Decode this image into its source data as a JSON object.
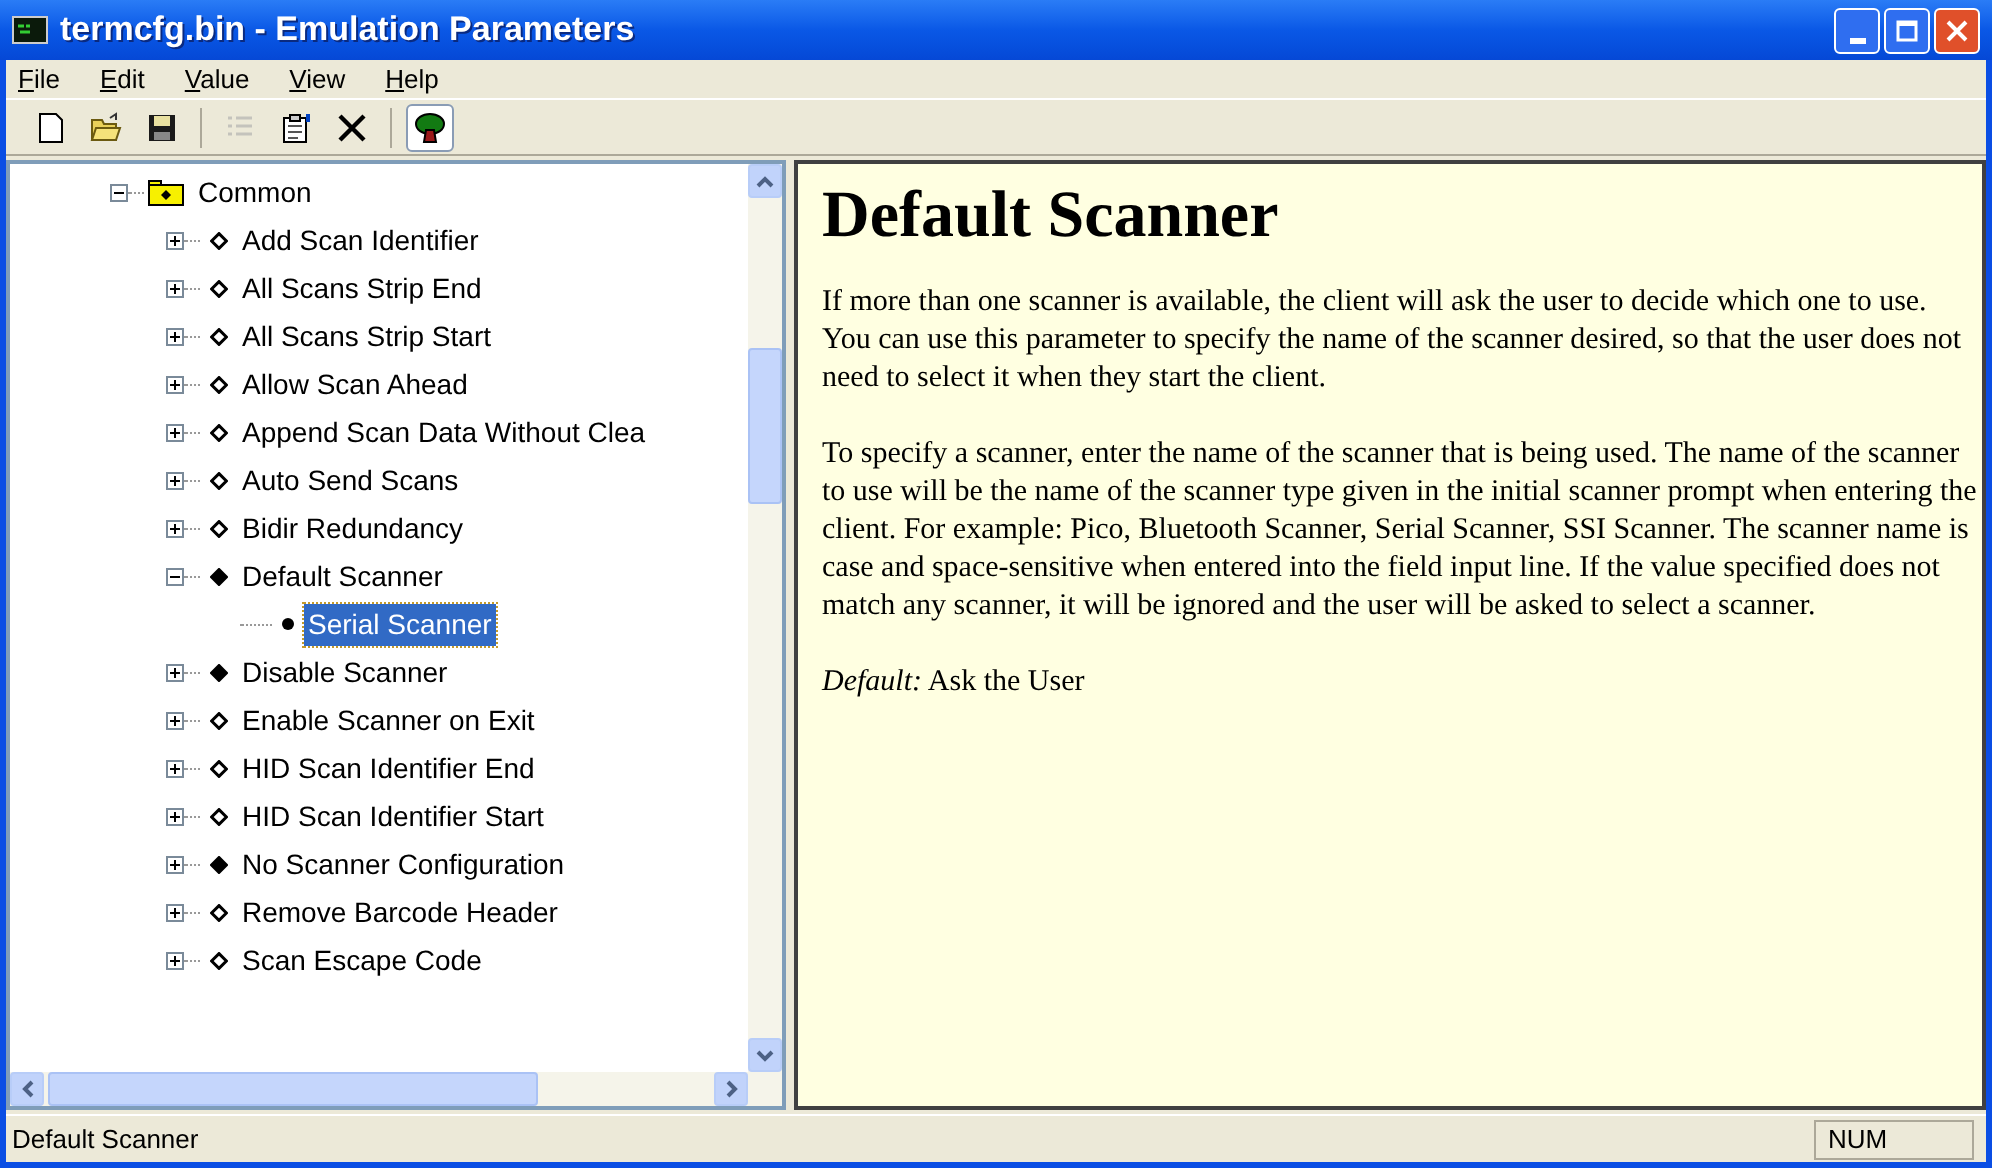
{
  "window": {
    "title": "termcfg.bin - Emulation Parameters"
  },
  "menu": [
    {
      "label": "File"
    },
    {
      "label": "Edit"
    },
    {
      "label": "Value"
    },
    {
      "label": "View"
    },
    {
      "label": "Help"
    }
  ],
  "toolbar": [
    {
      "kind": "new",
      "disabled": false,
      "pressed": false
    },
    {
      "kind": "open",
      "disabled": false,
      "pressed": false
    },
    {
      "kind": "save",
      "disabled": false,
      "pressed": false
    },
    {
      "kind": "separator"
    },
    {
      "kind": "list",
      "disabled": true,
      "pressed": false
    },
    {
      "kind": "properties",
      "disabled": false,
      "pressed": false
    },
    {
      "kind": "delete",
      "disabled": false,
      "pressed": false
    },
    {
      "kind": "separator"
    },
    {
      "kind": "tree",
      "disabled": false,
      "pressed": true
    }
  ],
  "tree": {
    "items": [
      {
        "label": "Common",
        "kind": "folder",
        "expanded": true,
        "selected": false,
        "children": [
          {
            "label": "Add Scan Identifier",
            "kind": "parameter",
            "set": false,
            "expanded": false,
            "selected": false
          },
          {
            "label": "All Scans Strip End",
            "kind": "parameter",
            "set": false,
            "expanded": false,
            "selected": false
          },
          {
            "label": "All Scans Strip Start",
            "kind": "parameter",
            "set": false,
            "expanded": false,
            "selected": false
          },
          {
            "label": "Allow Scan Ahead",
            "kind": "parameter",
            "set": false,
            "expanded": false,
            "selected": false
          },
          {
            "label": "Append Scan Data Without Clea",
            "kind": "parameter",
            "set": false,
            "expanded": false,
            "selected": false
          },
          {
            "label": "Auto Send Scans",
            "kind": "parameter",
            "set": false,
            "expanded": false,
            "selected": false
          },
          {
            "label": "Bidir Redundancy",
            "kind": "parameter",
            "set": false,
            "expanded": false,
            "selected": false
          },
          {
            "label": "Default Scanner",
            "kind": "parameter",
            "set": true,
            "expanded": true,
            "selected": false,
            "children": [
              {
                "label": "Serial Scanner",
                "kind": "value",
                "selected": true
              }
            ]
          },
          {
            "label": "Disable Scanner",
            "kind": "parameter",
            "set": true,
            "expanded": false,
            "selected": false
          },
          {
            "label": "Enable Scanner on Exit",
            "kind": "parameter",
            "set": false,
            "expanded": false,
            "selected": false
          },
          {
            "label": "HID Scan Identifier End",
            "kind": "parameter",
            "set": false,
            "expanded": false,
            "selected": false
          },
          {
            "label": "HID Scan Identifier Start",
            "kind": "parameter",
            "set": false,
            "expanded": false,
            "selected": false
          },
          {
            "label": "No Scanner Configuration",
            "kind": "parameter",
            "set": true,
            "expanded": false,
            "selected": false
          },
          {
            "label": "Remove Barcode Header",
            "kind": "parameter",
            "set": false,
            "expanded": false,
            "selected": false
          },
          {
            "label": "Scan Escape Code",
            "kind": "parameter",
            "set": false,
            "expanded": false,
            "selected": false
          }
        ]
      }
    ]
  },
  "help": {
    "title": "Default Scanner",
    "paragraphs": [
      "If more than one scanner is available, the client will ask the user to decide which one to use.  You can use this parameter to specify the name of the scanner desired, so that the user does not need to select it when they start the client.",
      "To specify a scanner, enter the name of the scanner that is being used.  The name of the scanner to use will be the name of the scanner type given in the initial scanner prompt when entering the client.  For example: Pico, Bluetooth Scanner, Serial Scanner, SSI Scanner.   The scanner name is case and space-sensitive when entered into the field input line.  If the value specified does not match any scanner, it will be ignored and the user will be asked to select a scanner.",
      "*Default:* Ask the User"
    ]
  },
  "status_bar": {
    "text": "Default Scanner",
    "panels": [
      "NUM"
    ]
  }
}
